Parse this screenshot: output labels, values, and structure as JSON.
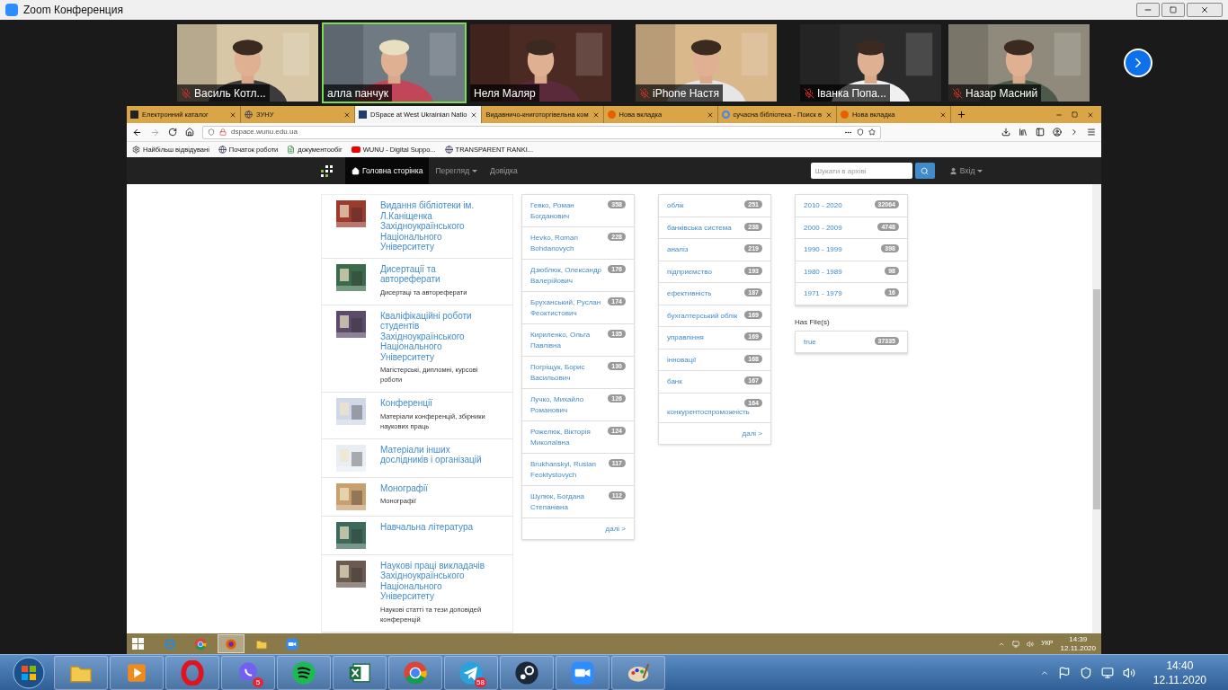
{
  "window": {
    "title": "Zoom Конференция"
  },
  "participants": [
    {
      "name": "Василь Котл...",
      "muted": true,
      "selected": false
    },
    {
      "name": "алла панчук",
      "muted": false,
      "selected": true
    },
    {
      "name": "Неля Маляр",
      "muted": false,
      "selected": false
    },
    {
      "name": "iPhone Настя",
      "muted": true,
      "selected": false
    },
    {
      "name": "Іванка Попа...",
      "muted": true,
      "selected": false
    },
    {
      "name": "Назар Масний",
      "muted": true,
      "selected": false
    }
  ],
  "browser": {
    "tabs": [
      {
        "label": "Електронний каталог",
        "selected": false,
        "kind": "catalog"
      },
      {
        "label": "ЗУНУ",
        "selected": false,
        "kind": "globe"
      },
      {
        "label": "DSpace at West Ukrainian Natio",
        "selected": true,
        "kind": "dspace"
      },
      {
        "label": "Видавничо-книготоргівельна ком",
        "selected": false,
        "kind": "blank"
      },
      {
        "label": "Нова вкладка",
        "selected": false,
        "kind": "fox"
      },
      {
        "label": "сучасна бібліотека - Поиск в",
        "selected": false,
        "kind": "search"
      },
      {
        "label": "Нова вкладка",
        "selected": false,
        "kind": "fox"
      }
    ],
    "url": "dspace.wunu.edu.ua",
    "bookmarks": [
      {
        "label": "Найбільш відвідувані",
        "kind": "gear"
      },
      {
        "label": "Початок роботи",
        "kind": "globe"
      },
      {
        "label": "документообіг",
        "kind": "doc"
      },
      {
        "label": "WUNU - Digital Suppo...",
        "kind": "video"
      },
      {
        "label": "TRANSPARENT RANKI...",
        "kind": "globe"
      }
    ]
  },
  "site_nav": {
    "items": [
      {
        "label": "Головна сторінка",
        "selected": true,
        "has_menu": false
      },
      {
        "label": "Перегляд",
        "selected": false,
        "has_menu": true
      },
      {
        "label": "Довідка",
        "selected": false,
        "has_menu": false
      }
    ],
    "search_placeholder": "Шукати в архіві",
    "user": "Вхід"
  },
  "communities": [
    {
      "title": "Видання бібліотеки ім. Л.Каніщенка Західноукраїнського Національного Університету"
    },
    {
      "title": "Дисертації та автореферати",
      "description": "Дисертаці та автореферати"
    },
    {
      "title": "Кваліфікаційні роботи студентів Західноукраїнського Національного Університету",
      "description": "Магістерські, дипломні, курсові роботи"
    },
    {
      "title": "Конференції",
      "description": "Матеріали конференцій, збірники наукових праць"
    },
    {
      "title": "Матеріали інших дослідників і організацій"
    },
    {
      "title": "Монографії",
      "description": "Монографії"
    },
    {
      "title": "Навчальна література"
    },
    {
      "title": "Наукові праці викладачів Західноукраїнського Національного Університету",
      "description": "Наукові статті та тези доповідей конференцій"
    }
  ],
  "facets": [
    {
      "items": [
        {
          "label": "Гевко, Роман Богданович",
          "count": "358"
        },
        {
          "label": "Hevko, Roman Bohdanovych",
          "count": "228"
        },
        {
          "label": "Дзюблюк, Олександр Валерійович",
          "count": "176"
        },
        {
          "label": "Бруханський, Руслан Феоктистович",
          "count": "174"
        },
        {
          "label": "Кириленко, Ольга Павлівна",
          "count": "135"
        },
        {
          "label": "Погріщук, Борис Васильович",
          "count": "130"
        },
        {
          "label": "Лучко, Михайло Романович",
          "count": "126"
        },
        {
          "label": "Рожелюк, Вікторія Миколаївна",
          "count": "124"
        },
        {
          "label": "Brukhanskyi, Ruslan Feoktystovych",
          "count": "117"
        },
        {
          "label": "Шулюк, Богдана Степанівна",
          "count": "112"
        }
      ],
      "more": "далі >"
    },
    {
      "items": [
        {
          "label": "облік",
          "count": "251"
        },
        {
          "label": "банківська система",
          "count": "238"
        },
        {
          "label": "аналіз",
          "count": "219"
        },
        {
          "label": "підприємство",
          "count": "193"
        },
        {
          "label": "ефективність",
          "count": "187"
        },
        {
          "label": "бухгалтерський облік",
          "count": "169"
        },
        {
          "label": "управління",
          "count": "169"
        },
        {
          "label": "інновації",
          "count": "168"
        },
        {
          "label": "банк",
          "count": "167"
        },
        {
          "label": "конкурентоспроможність",
          "count": "164"
        }
      ],
      "more": "далі >"
    },
    {
      "items": [
        {
          "label": "2010 - 2020",
          "count": "32064"
        },
        {
          "label": "2000 - 2009",
          "count": "4748"
        },
        {
          "label": "1990 - 1999",
          "count": "398"
        },
        {
          "label": "1980 - 1989",
          "count": "98"
        },
        {
          "label": "1971 - 1979",
          "count": "16"
        }
      ],
      "after": {
        "heading": "Has File(s)",
        "items": [
          {
            "label": "true",
            "count": "37335"
          }
        ]
      }
    }
  ],
  "remote_taskbar": {
    "apps": [
      {
        "kind": "ie",
        "selected": false
      },
      {
        "kind": "chrome",
        "selected": false
      },
      {
        "kind": "fox",
        "selected": true
      },
      {
        "kind": "folder",
        "selected": false
      },
      {
        "kind": "zoom",
        "selected": false
      }
    ],
    "language": "УКР",
    "time": "14:39",
    "date": "12.11.2020"
  },
  "taskbar": {
    "apps": [
      {
        "kind": "folder"
      },
      {
        "kind": "player"
      },
      {
        "kind": "opera"
      },
      {
        "kind": "viber",
        "badge": "5"
      },
      {
        "kind": "spotify"
      },
      {
        "kind": "excel"
      },
      {
        "kind": "chrome"
      },
      {
        "kind": "telegram",
        "badge": "58"
      },
      {
        "kind": "steam"
      },
      {
        "kind": "zoom"
      },
      {
        "kind": "paint"
      }
    ],
    "time": "14:40",
    "date": "12.11.2020"
  }
}
